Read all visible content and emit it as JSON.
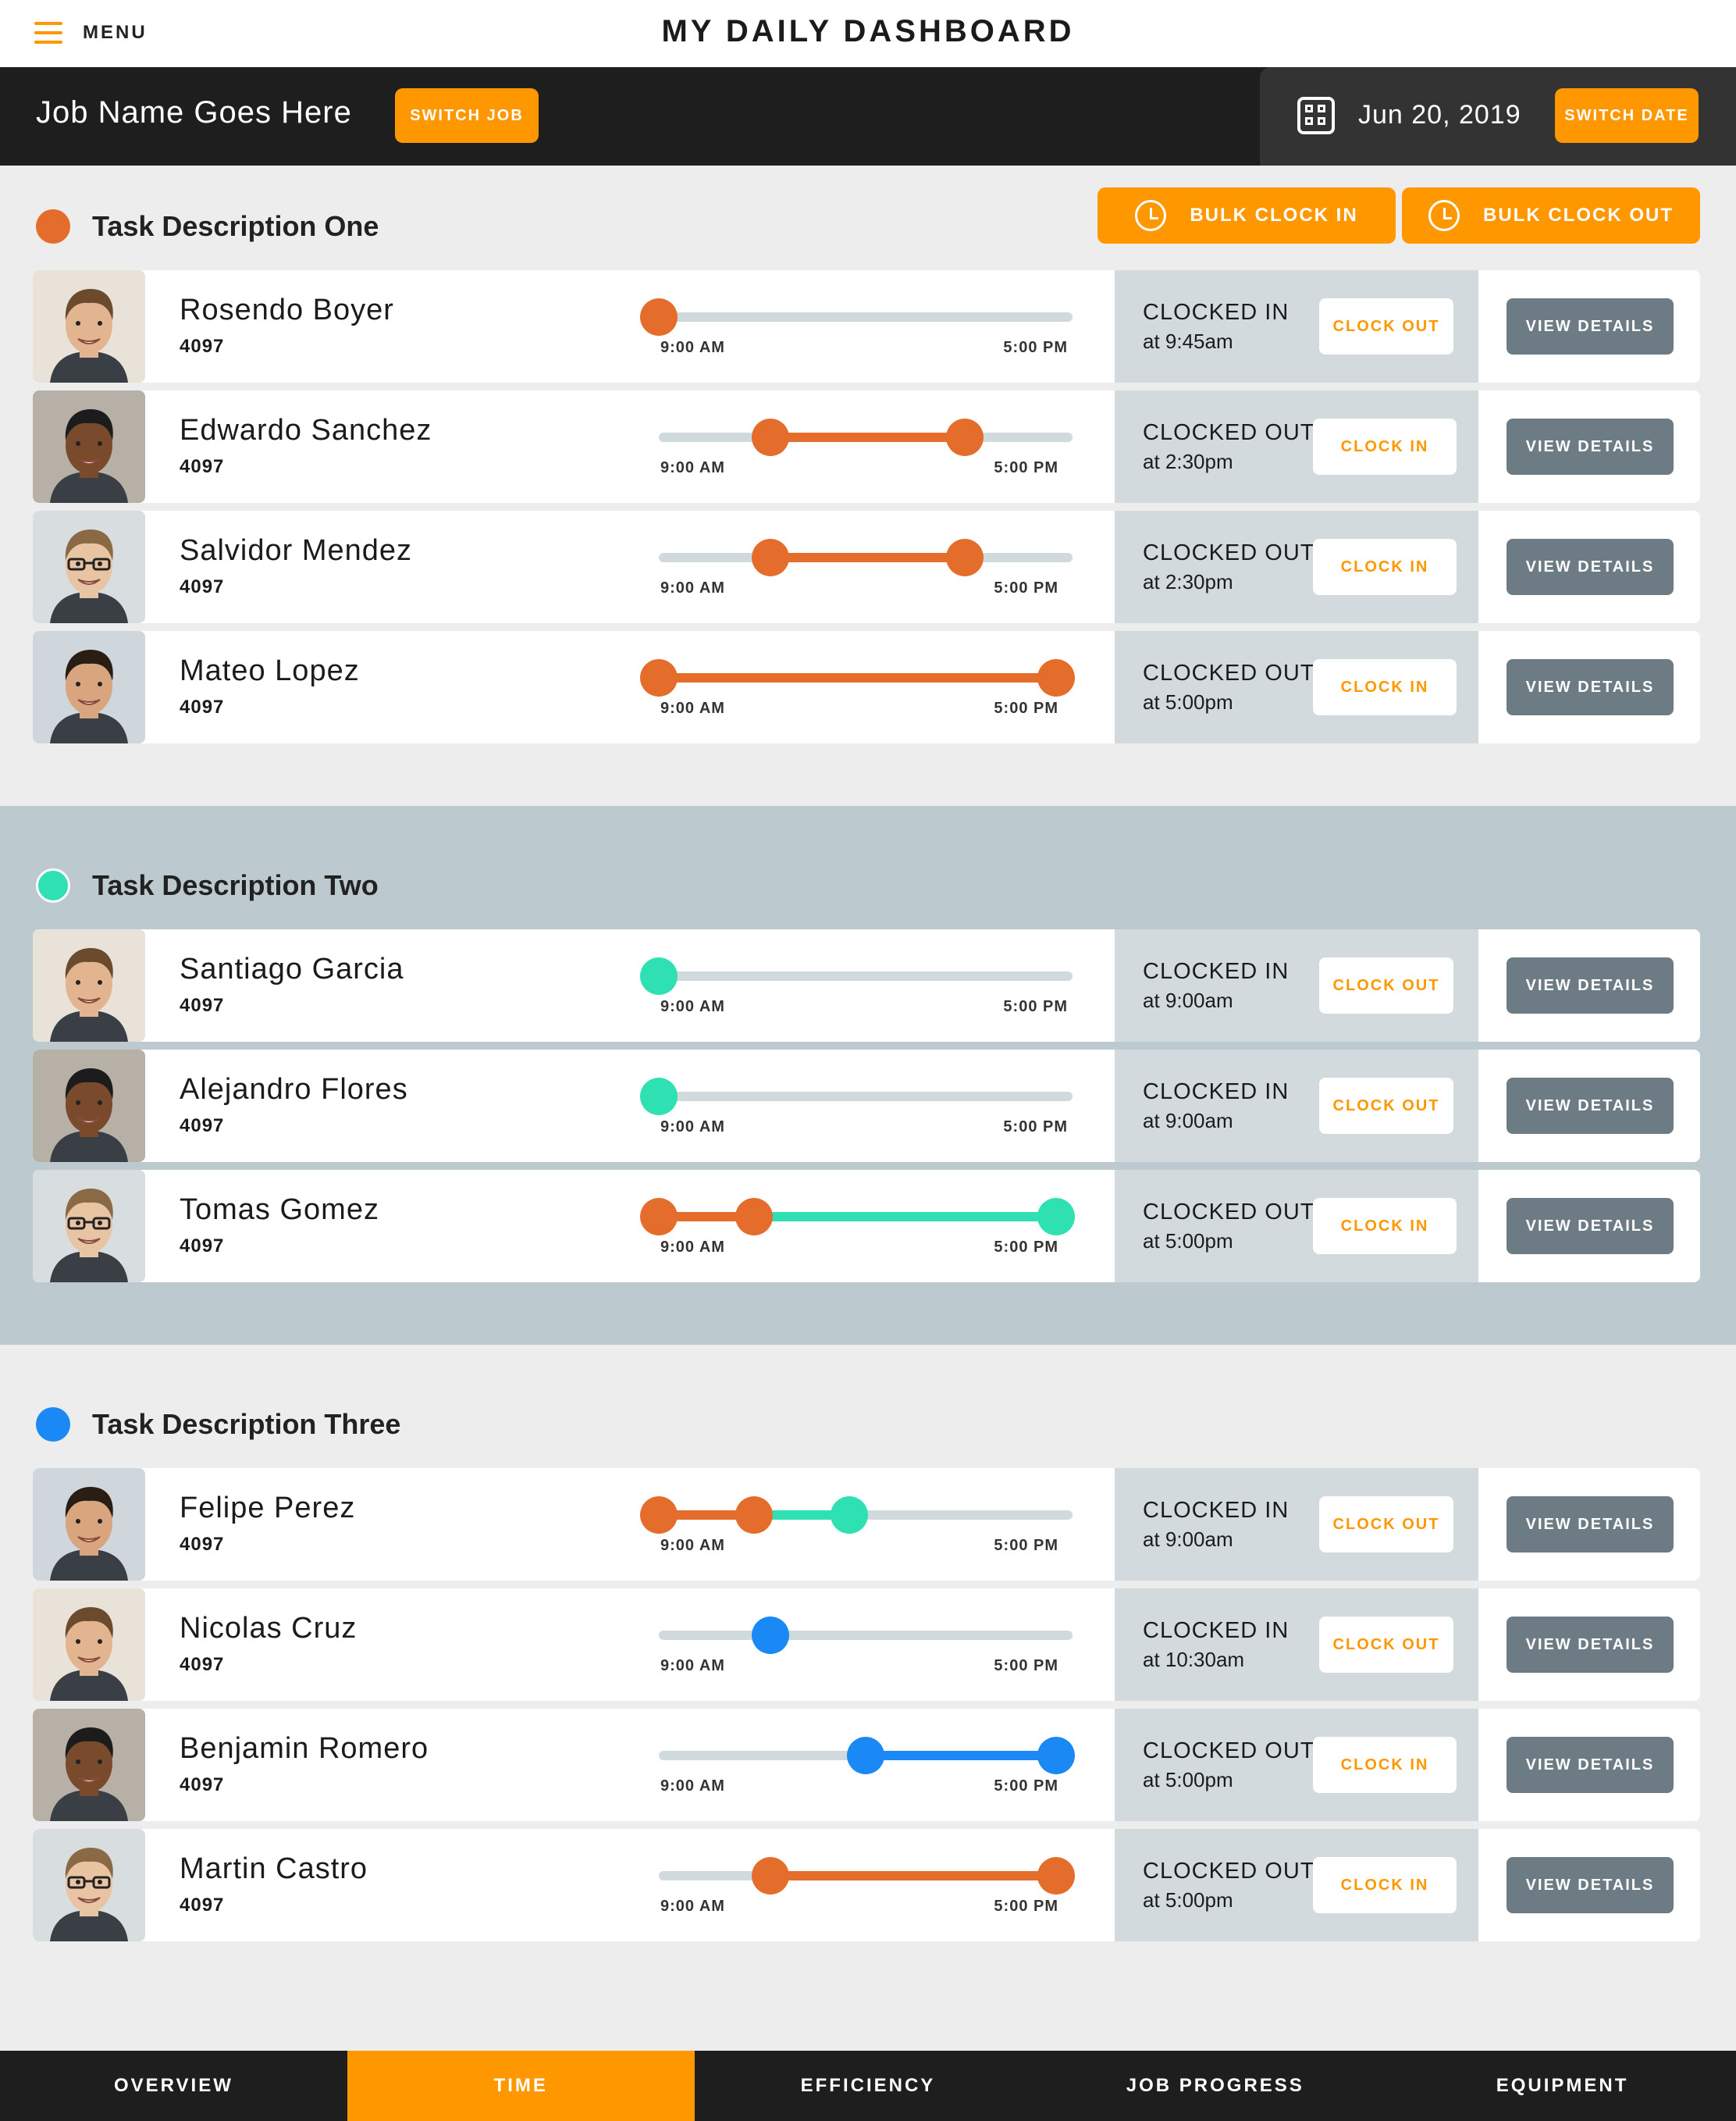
{
  "header": {
    "menu_label": "MENU",
    "title": "MY DAILY DASHBOARD"
  },
  "job": {
    "name": "Job Name Goes Here",
    "switch_job_label": "SWITCH JOB",
    "date": "Jun 20, 2019",
    "switch_date_label": "SWITCH DATE"
  },
  "bulk": {
    "clock_in_label": "BULK CLOCK IN",
    "clock_out_label": "BULK CLOCK OUT"
  },
  "colors": {
    "accent": "#ff9800",
    "task1": "#e56d2c",
    "task2": "#2fe0b3",
    "task3": "#1a88f5",
    "track": "#d0d9dc"
  },
  "timeline_labels": {
    "start": "9:00 AM",
    "end": "5:00 PM"
  },
  "buttons": {
    "clock_in": "CLOCK IN",
    "clock_out": "CLOCK OUT",
    "view_details": "VIEW DETAILS"
  },
  "tasks": [
    {
      "title": "Task Description One",
      "color": "#e56d2c",
      "employees": [
        {
          "name": "Rosendo Boyer",
          "id": "4097",
          "status": "CLOCKED IN",
          "time": "at 9:45am",
          "action": "CLOCK OUT",
          "knobs": [
            0.0
          ],
          "segments": []
        },
        {
          "name": "Edwardo Sanchez",
          "id": "4097",
          "status": "CLOCKED OUT",
          "time": "at 2:30pm",
          "action": "CLOCK IN",
          "knobs": [
            0.27,
            0.74
          ],
          "segments": [
            [
              0.27,
              0.74,
              "#e56d2c"
            ]
          ]
        },
        {
          "name": "Salvidor Mendez",
          "id": "4097",
          "status": "CLOCKED OUT",
          "time": "at 2:30pm",
          "action": "CLOCK IN",
          "knobs": [
            0.27,
            0.74
          ],
          "segments": [
            [
              0.27,
              0.74,
              "#e56d2c"
            ]
          ]
        },
        {
          "name": "Mateo Lopez",
          "id": "4097",
          "status": "CLOCKED OUT",
          "time": "at 5:00pm",
          "action": "CLOCK IN",
          "knobs": [
            0.0,
            0.96
          ],
          "segments": [
            [
              0.0,
              0.96,
              "#e56d2c"
            ]
          ]
        }
      ]
    },
    {
      "title": "Task Description Two",
      "color": "#2fe0b3",
      "employees": [
        {
          "name": "Santiago Garcia",
          "id": "4097",
          "status": "CLOCKED IN",
          "time": "at 9:00am",
          "action": "CLOCK OUT",
          "knobs": [
            0.0
          ],
          "segments": []
        },
        {
          "name": "Alejandro Flores",
          "id": "4097",
          "status": "CLOCKED IN",
          "time": "at 9:00am",
          "action": "CLOCK OUT",
          "knobs": [
            0.0
          ],
          "segments": []
        },
        {
          "name": "Tomas Gomez",
          "id": "4097",
          "status": "CLOCKED OUT",
          "time": "at 5:00pm",
          "action": "CLOCK IN",
          "knobs": [
            0.0,
            0.23,
            0.96
          ],
          "segments": [
            [
              0.0,
              0.23,
              "#e56d2c"
            ],
            [
              0.23,
              0.96,
              "#2fe0b3"
            ]
          ]
        }
      ]
    },
    {
      "title": "Task Description Three",
      "color": "#1a88f5",
      "employees": [
        {
          "name": "Felipe Perez",
          "id": "4097",
          "status": "CLOCKED IN",
          "time": "at 9:00am",
          "action": "CLOCK OUT",
          "knobs": [
            0.0,
            0.23,
            0.46
          ],
          "segments": [
            [
              0.0,
              0.23,
              "#e56d2c"
            ],
            [
              0.23,
              0.46,
              "#2fe0b3"
            ]
          ]
        },
        {
          "name": "Nicolas Cruz",
          "id": "4097",
          "status": "CLOCKED IN",
          "time": "at 10:30am",
          "action": "CLOCK OUT",
          "knobs": [
            0.27
          ],
          "segments": []
        },
        {
          "name": "Benjamin Romero",
          "id": "4097",
          "status": "CLOCKED OUT",
          "time": "at 5:00pm",
          "action": "CLOCK IN",
          "knobs": [
            0.5,
            0.96
          ],
          "segments": [
            [
              0.5,
              0.96,
              "#1a88f5"
            ]
          ]
        },
        {
          "name": "Martin Castro",
          "id": "4097",
          "status": "CLOCKED OUT",
          "time": "at 5:00pm",
          "action": "CLOCK IN",
          "knobs": [
            0.27,
            0.96
          ],
          "segments": [
            [
              0.27,
              0.96,
              "#e56d2c"
            ]
          ]
        }
      ]
    }
  ],
  "nav": {
    "tabs": [
      "OVERVIEW",
      "TIME",
      "EFFICIENCY",
      "JOB PROGRESS",
      "EQUIPMENT"
    ],
    "active": "TIME"
  }
}
